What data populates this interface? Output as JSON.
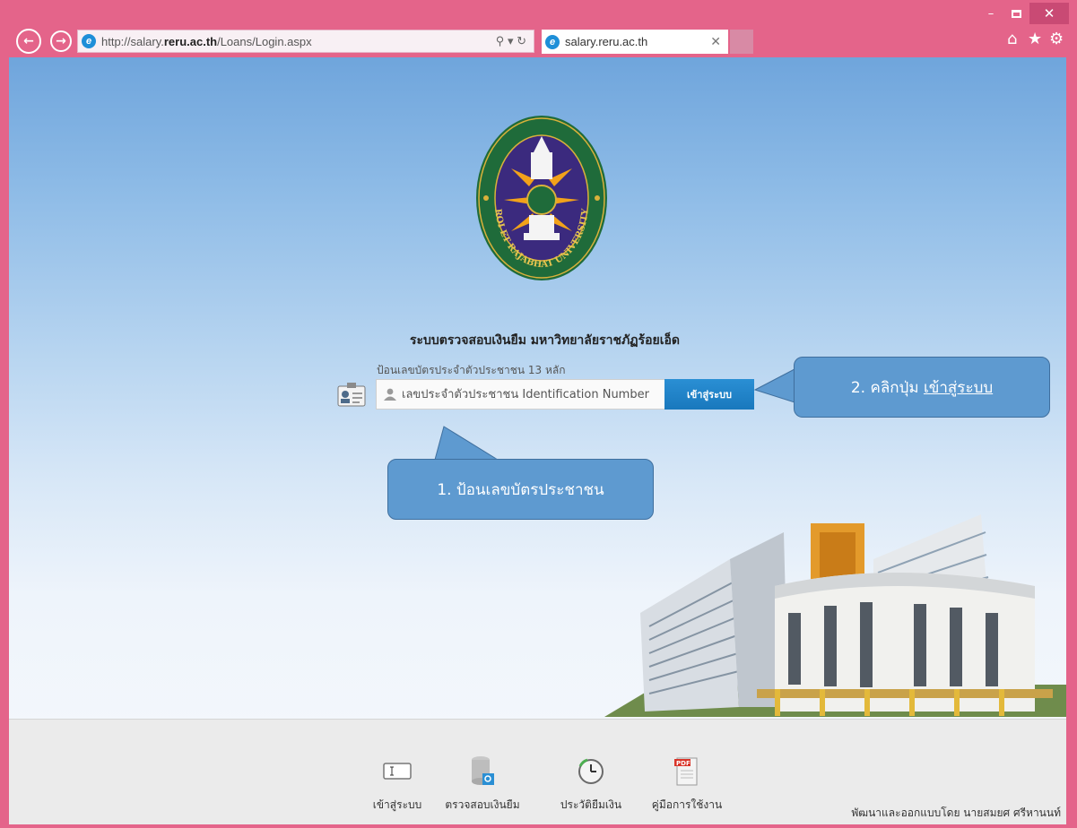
{
  "browser": {
    "url_prefix": "http://salary.",
    "url_domain": "reru.ac.th",
    "url_path": "/Loans/Login.aspx",
    "tab_title": "salary.reru.ac.th",
    "window_controls": {
      "minimize": "–",
      "close": "✕"
    }
  },
  "page": {
    "title": "ระบบตรวจสอบเงินยืม มหาวิทยาลัยราชภัฏร้อยเอ็ด",
    "hint": "ป้อนเลขบัตรประจำตัวประชาชน 13 หลัก",
    "input_placeholder": "เลขประจำตัวประชาชน Identification Number",
    "login_button": "เข้าสู่ระบบ",
    "logo_text": "ROI ET RAJABHAT UNIVERSITY"
  },
  "callouts": {
    "step1": "1. ป้อนเลขบัตรประชาชน",
    "step2_prefix": "2. คลิกปุ่ม ",
    "step2_link": "เข้าสู่ระบบ"
  },
  "footer": {
    "items": [
      {
        "label": "เข้าสู่ระบบ",
        "icon": "login-icon"
      },
      {
        "label": "ตรวจสอบเงินยืม",
        "icon": "database-search-icon"
      },
      {
        "label": "ประวัติยืมเงิน",
        "icon": "history-clock-icon"
      },
      {
        "label": "คู่มือการใช้งาน",
        "icon": "pdf-icon"
      }
    ],
    "credit": "พัฒนาและออกแบบโดย นายสมยศ ศรีหานนท์"
  },
  "colors": {
    "frame": "#e4648a",
    "login_button": "#1f84c8",
    "callout": "#5e9ad0",
    "logo_green": "#1f6b3a",
    "logo_purple": "#3b2a7e"
  }
}
